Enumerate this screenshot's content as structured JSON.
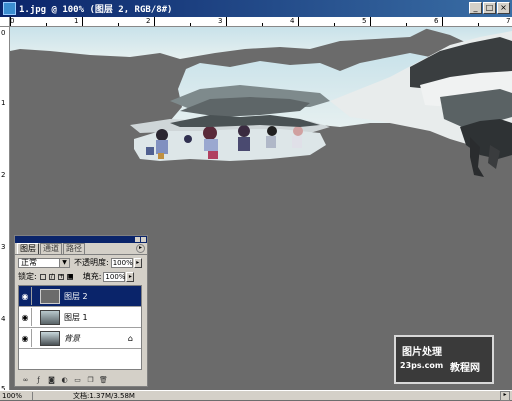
{
  "window": {
    "title": "1.jpg @ 100% (图层 2, RGB/8#)"
  },
  "rulers": {
    "top_numbers": [
      "0",
      "1",
      "2",
      "3",
      "4",
      "5",
      "6",
      "7"
    ],
    "left_numbers": [
      "0",
      "1",
      "2",
      "3",
      "4",
      "5"
    ]
  },
  "layers_panel": {
    "tabs": [
      "图层",
      "通道",
      "路径"
    ],
    "blend_mode": "正常",
    "opacity_label": "不透明度:",
    "opacity_value": "100%",
    "lock_label": "锁定:",
    "fill_label": "填充:",
    "fill_value": "100%",
    "layers": [
      {
        "name": "图层 2",
        "selected": true
      },
      {
        "name": "图层 1",
        "selected": false
      },
      {
        "name": "背景",
        "selected": false,
        "locked": true
      }
    ],
    "bottom_icons": [
      "link-icon",
      "style-icon",
      "mask-icon",
      "adjustment-icon",
      "group-icon",
      "new-layer-icon",
      "trash-icon"
    ]
  },
  "status": {
    "zoom": "100%",
    "doc": "文档:1.37M/3.58M"
  },
  "watermark": {
    "line1": "图片处理",
    "line2": "23ps.com",
    "line3": "教程网"
  },
  "colors": {
    "titlebar": "#0a246a",
    "canvas": "#6b6b6b",
    "panel": "#d4d0c8",
    "selection": "#0a246a"
  }
}
